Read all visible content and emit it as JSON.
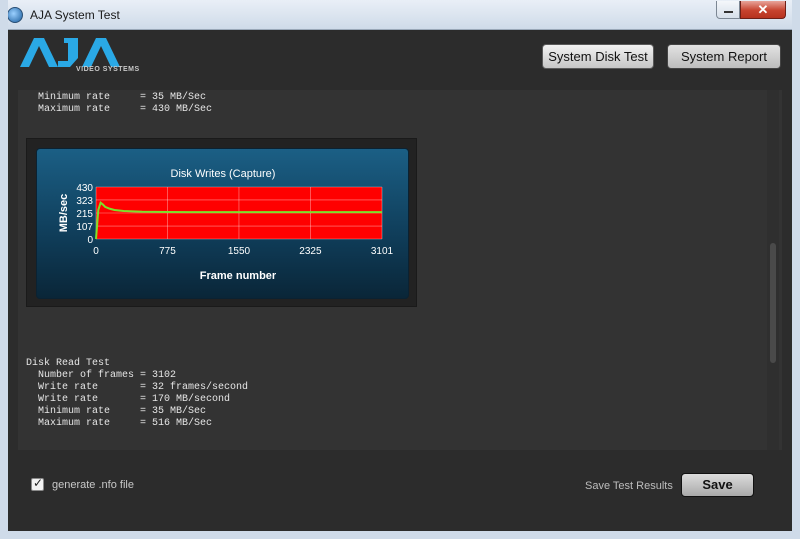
{
  "window": {
    "title": "AJA System Test",
    "close_glyph": "✕"
  },
  "logo": {
    "brand": "AJA",
    "subtitle": "VIDEO SYSTEMS"
  },
  "header": {
    "disk_test_label": "System Disk Test",
    "report_label": "System Report"
  },
  "output": {
    "write_tail_lines": [
      "  Minimum rate     = 35 MB/Sec",
      "  Maximum rate     = 430 MB/Sec"
    ],
    "read_test_lines": [
      "Disk Read Test",
      "  Number of frames = 3102",
      "  Write rate       = 32 frames/second",
      "  Write rate       = 170 MB/second",
      "  Minimum rate     = 35 MB/Sec",
      "  Maximum rate     = 516 MB/Sec"
    ]
  },
  "chart_data": {
    "type": "area",
    "title": "Disk Writes (Capture)",
    "xlabel": "Frame number",
    "ylabel": "MB/sec",
    "x_ticks": [
      "0",
      "775",
      "1550",
      "2325",
      "3101"
    ],
    "y_ticks": [
      "430",
      "323",
      "215",
      "107",
      "0"
    ],
    "xlim": [
      0,
      3101
    ],
    "ylim": [
      0,
      430
    ],
    "series": [
      {
        "x": [
          0,
          25,
          50,
          75,
          100,
          150,
          200,
          300,
          400,
          500,
          775,
          1000,
          1550,
          2000,
          2325,
          2800,
          3101
        ],
        "values": [
          0,
          240,
          300,
          285,
          265,
          250,
          240,
          232,
          228,
          225,
          223,
          222,
          222,
          222,
          222,
          222,
          222
        ]
      }
    ],
    "fill_color": "#ff0000",
    "line_color": "#7ee02a",
    "grid": true
  },
  "footer": {
    "checkbox_label": "generate .nfo file",
    "checkbox_checked": true,
    "checkbox_glyph": "✓",
    "save_results_label": "Save Test Results",
    "save_button_label": "Save"
  }
}
